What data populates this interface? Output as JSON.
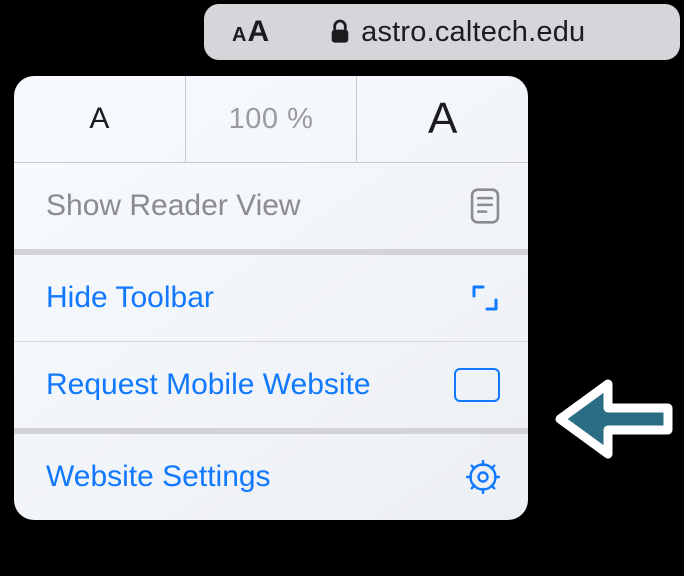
{
  "url_bar": {
    "domain": "astro.caltech.edu"
  },
  "popover": {
    "zoom": {
      "percent": "100 %"
    },
    "reader": {
      "label": "Show Reader View"
    },
    "hide_toolbar": {
      "label": "Hide Toolbar"
    },
    "request_mobile": {
      "label": "Request Mobile Website"
    },
    "website_settings": {
      "label": "Website Settings"
    }
  }
}
